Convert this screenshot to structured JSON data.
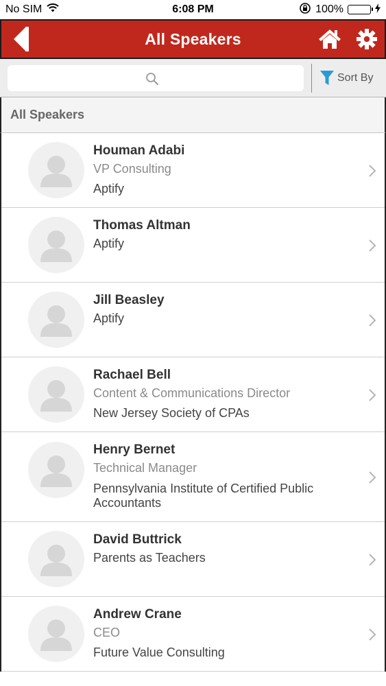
{
  "status_bar": {
    "carrier": "No SIM",
    "time": "6:08 PM",
    "battery_percent": "100%",
    "battery_level": 1.0,
    "icons": [
      "wifi-icon",
      "rotation-lock-icon",
      "battery-icon",
      "charging-icon"
    ]
  },
  "nav": {
    "title": "All Speakers",
    "back_icon": "back-arrow-icon",
    "home_icon": "home-icon",
    "settings_icon": "gear-icon",
    "bar_color": "#c0281d"
  },
  "search": {
    "placeholder": "",
    "value": "",
    "icon": "search-icon",
    "sort_label": "Sort By",
    "sort_icon": "funnel-icon",
    "sort_icon_color": "#2a9ad6"
  },
  "section": {
    "title": "All Speakers"
  },
  "speakers": [
    {
      "name": "Houman Adabi",
      "title": "VP Consulting",
      "company": "Aptify"
    },
    {
      "name": "Thomas Altman",
      "title": "",
      "company": "Aptify"
    },
    {
      "name": "Jill Beasley",
      "title": "",
      "company": "Aptify"
    },
    {
      "name": "Rachael Bell",
      "title": "Content & Communications Director",
      "company": "New Jersey Society of CPAs"
    },
    {
      "name": "Henry Bernet",
      "title": "Technical Manager",
      "company": "Pennsylvania Institute of Certified Public Accountants"
    },
    {
      "name": "David Buttrick",
      "title": "",
      "company": "Parents as Teachers"
    },
    {
      "name": "Andrew Crane",
      "title": "CEO",
      "company": "Future Value Consulting"
    }
  ]
}
